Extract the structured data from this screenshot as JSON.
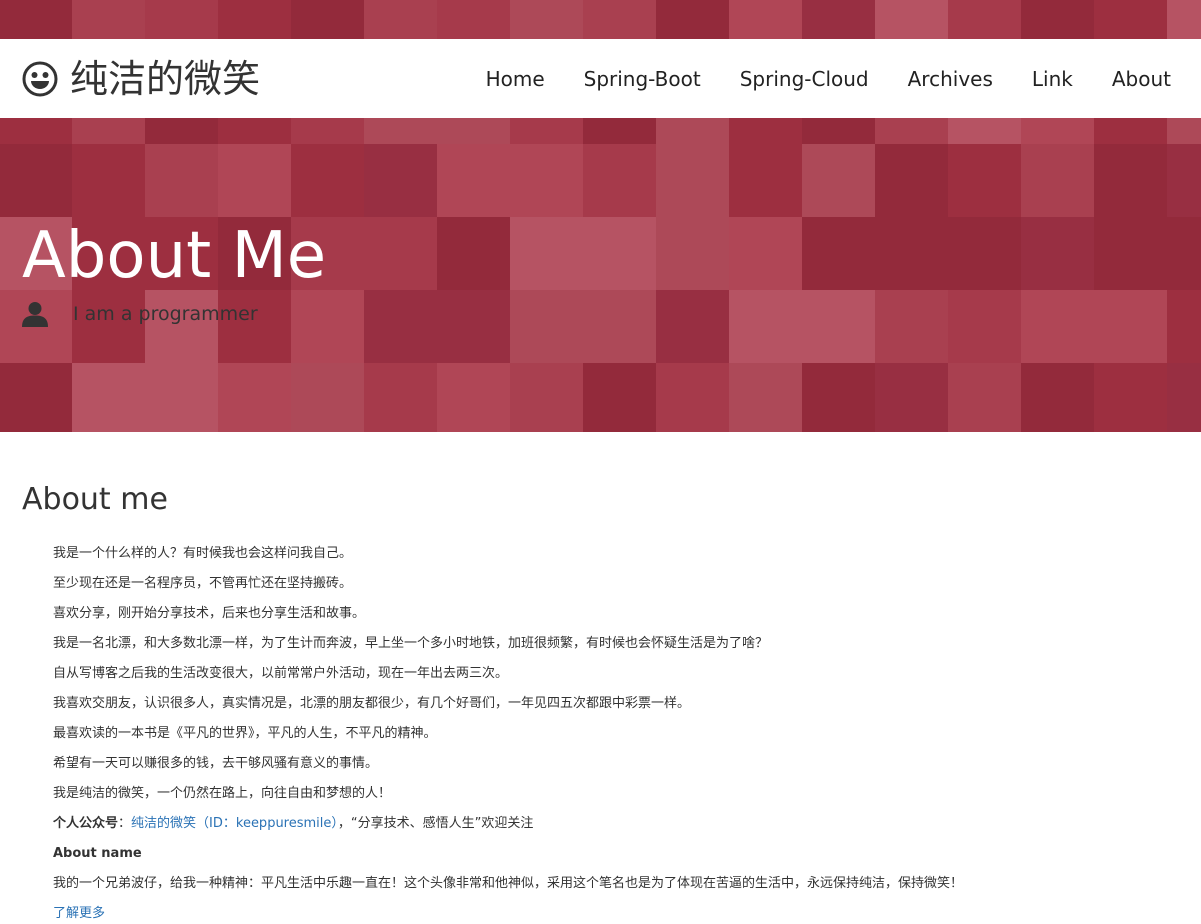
{
  "brand": {
    "name": "纯洁的微笑",
    "icon": "smiley-icon"
  },
  "nav": {
    "items": [
      "Home",
      "Spring-Boot",
      "Spring-Cloud",
      "Archives",
      "Link",
      "About"
    ]
  },
  "hero": {
    "title": "About Me",
    "subtitle": "I am a programmer",
    "icon": "user-icon",
    "palette": [
      "#a63a4b",
      "#9d2f40",
      "#b04656",
      "#932a3b",
      "#a94050",
      "#b65363",
      "#982f42",
      "#ad4958"
    ]
  },
  "main": {
    "section_title": "About me",
    "paragraphs": [
      "我是一个什么样的人？有时候我也会这样问我自己。",
      "至少现在还是一名程序员，不管再忙还在坚持搬砖。",
      "喜欢分享，刚开始分享技术，后来也分享生活和故事。",
      "我是一名北漂，和大多数北漂一样，为了生计而奔波，早上坐一个多小时地铁，加班很频繁，有时候也会怀疑生活是为了啥？",
      "自从写博客之后我的生活改变很大，以前常常户外活动，现在一年出去两三次。",
      "我喜欢交朋友，认识很多人，真实情况是，北漂的朋友都很少，有几个好哥们，一年见四五次都跟中彩票一样。",
      "最喜欢读的一本书是《平凡的世界》，平凡的人生，不平凡的精神。",
      "希望有一天可以赚很多的钱，去干够风骚有意义的事情。",
      "我是纯洁的微笑，一个仍然在路上，向往自由和梦想的人！"
    ],
    "wechat": {
      "label": "个人公众号",
      "sep": "：",
      "link_text": "纯洁的微笑（ID：keeppuresmile）",
      "after": "，“分享技术、感悟人生”欢迎关注"
    },
    "about_name_heading": "About name",
    "about_name_text": "我的一个兄弟波仔，给我一种精神：平凡生活中乐趣一直在！这个头像非常和他神似，采用这个笔名也是为了体现在苦逼的生活中，永远保持纯洁，保持微笑！",
    "more_link": "了解更多"
  }
}
